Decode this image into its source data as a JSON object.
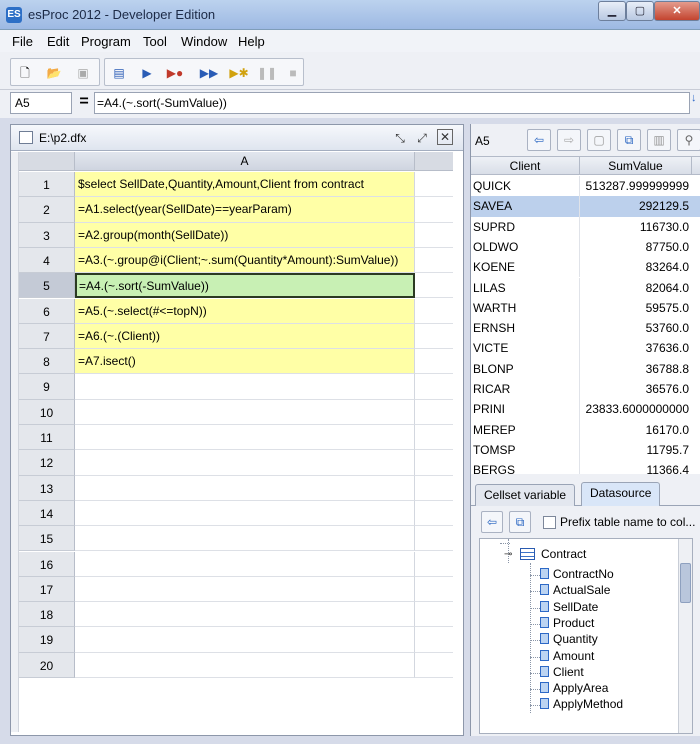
{
  "window": {
    "title": "esProc 2012 - Developer Edition",
    "app_icon": "ES"
  },
  "menu": [
    "File",
    "Edit",
    "Program",
    "Tool",
    "Window",
    "Help"
  ],
  "formula_bar": {
    "cell_name": "A5",
    "formula": "=A4.(~.sort(-SumValue))"
  },
  "editor": {
    "filename": "E:\\p2.dfx",
    "column_header": "A",
    "rows": [
      {
        "num": "1",
        "code": "$select SellDate,Quantity,Amount,Client from contract"
      },
      {
        "num": "2",
        "code": "=A1.select(year(SellDate)==yearParam)"
      },
      {
        "num": "3",
        "code": "=A2.group(month(SellDate))"
      },
      {
        "num": "4",
        "code": "=A3.(~.group@i(Client;~.sum(Quantity*Amount):SumValue))"
      },
      {
        "num": "5",
        "code": "=A4.(~.sort(-SumValue))"
      },
      {
        "num": "6",
        "code": "=A5.(~.select(#<=topN))"
      },
      {
        "num": "7",
        "code": "=A6.(~.(Client))"
      },
      {
        "num": "8",
        "code": "=A7.isect()"
      },
      {
        "num": "9",
        "code": ""
      },
      {
        "num": "10",
        "code": ""
      },
      {
        "num": "11",
        "code": ""
      },
      {
        "num": "12",
        "code": ""
      },
      {
        "num": "13",
        "code": ""
      },
      {
        "num": "14",
        "code": ""
      },
      {
        "num": "15",
        "code": ""
      },
      {
        "num": "16",
        "code": ""
      },
      {
        "num": "17",
        "code": ""
      },
      {
        "num": "18",
        "code": ""
      },
      {
        "num": "19",
        "code": ""
      },
      {
        "num": "20",
        "code": ""
      }
    ]
  },
  "result_panel": {
    "cell_name": "A5",
    "columns": [
      "Client",
      "SumValue"
    ],
    "rows": [
      {
        "client": "QUICK",
        "sum": "513287.999999999"
      },
      {
        "client": "SAVEA",
        "sum": "292129.5"
      },
      {
        "client": "SUPRD",
        "sum": "116730.0"
      },
      {
        "client": "OLDWO",
        "sum": "87750.0"
      },
      {
        "client": "KOENE",
        "sum": "83264.0"
      },
      {
        "client": "LILAS",
        "sum": "82064.0"
      },
      {
        "client": "WARTH",
        "sum": "59575.0"
      },
      {
        "client": "ERNSH",
        "sum": "53760.0"
      },
      {
        "client": "VICTE",
        "sum": "37636.0"
      },
      {
        "client": "BLONP",
        "sum": "36788.8"
      },
      {
        "client": "RICAR",
        "sum": "36576.0"
      },
      {
        "client": "PRINI",
        "sum": "23833.6000000000"
      },
      {
        "client": "MEREP",
        "sum": "16170.0"
      },
      {
        "client": "TOMSP",
        "sum": "11795.7"
      },
      {
        "client": "BERGS",
        "sum": "11366.4"
      }
    ]
  },
  "tabs": [
    "Cellset variable",
    "Datasource"
  ],
  "datasource": {
    "prefix_label": "Prefix table name to col...",
    "table": "Contract",
    "fields": [
      "ContractNo",
      "ActualSale",
      "SellDate",
      "Product",
      "Quantity",
      "Amount",
      "Client",
      "ApplyArea",
      "ApplyMethod"
    ]
  }
}
